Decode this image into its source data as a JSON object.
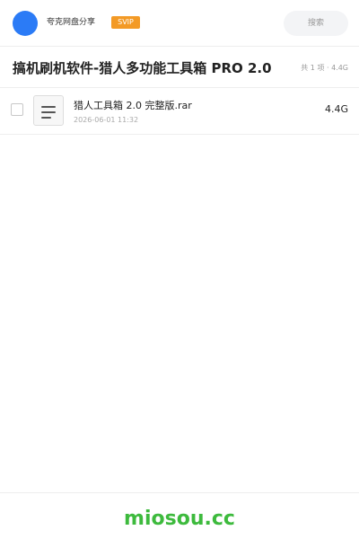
{
  "header": {
    "user_name": "夸克网盘分享",
    "badge": "SVIP",
    "search_placeholder": "搜索"
  },
  "share": {
    "title": "搞机刷机软件-猎人多功能工具箱 PRO 2.0",
    "summary": "共 1 项 · 4.4G"
  },
  "files": [
    {
      "name": "猎人工具箱 2.0 完整版.rar",
      "date": "2026-06-01 11:32",
      "size": "4.4G",
      "icon": "document-icon"
    }
  ],
  "footer": {
    "watermark": "miosou.cc"
  },
  "colors": {
    "avatar": "#2b7bf6",
    "badge": "#f39a26",
    "watermark": "#3dba3d"
  }
}
